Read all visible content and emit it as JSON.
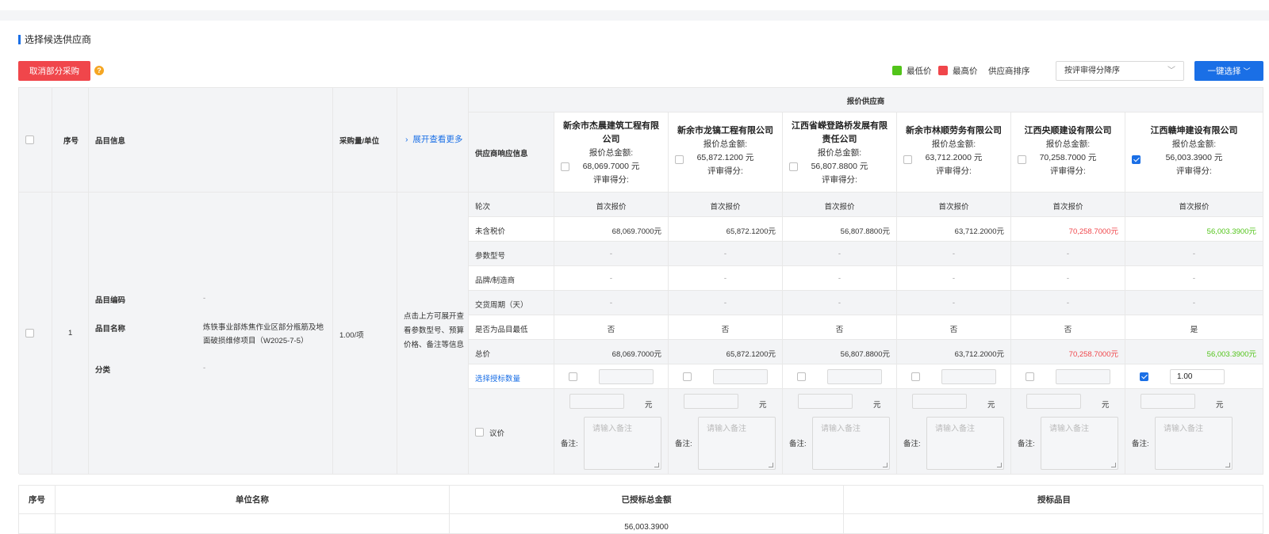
{
  "section_title": "选择候选供应商",
  "toolbar": {
    "cancel_label": "取消部分采购",
    "help_glyph": "?",
    "legend_low": "最低价",
    "legend_high": "最高价",
    "sort_label": "供应商排序",
    "sort_value": "按评审得分降序",
    "select_label": "一键选择",
    "colors": {
      "low": "#52c41a",
      "high": "#f0464b",
      "primary": "#1a6fe6"
    }
  },
  "table": {
    "headers": {
      "index": "序号",
      "item_info": "品目信息",
      "qty_unit": "采购量/单位",
      "expand": "展开查看更多",
      "suppliers_group": "报价供应商",
      "response_info": "供应商响应信息"
    },
    "quote_total_label": "报价总金额:",
    "score_label": "评审得分:",
    "suppliers": [
      {
        "name": "新余市杰晨建筑工程有限公司",
        "total": "68,069.7000 元",
        "checked": false,
        "round": "首次报价",
        "untaxed": "68,069.7000元",
        "param": "-",
        "brand": "-",
        "delivery": "-",
        "lowest": "否",
        "price": "68,069.7000元",
        "price_tag": "",
        "qty": ""
      },
      {
        "name": "新余市龙镐工程有限公司",
        "total": "65,872.1200 元",
        "checked": false,
        "round": "首次报价",
        "untaxed": "65,872.1200元",
        "param": "-",
        "brand": "-",
        "delivery": "-",
        "lowest": "否",
        "price": "65,872.1200元",
        "price_tag": "",
        "qty": ""
      },
      {
        "name": "江西省嵘登路桥发展有限责任公司",
        "total": "56,807.8800 元",
        "checked": false,
        "round": "首次报价",
        "untaxed": "56,807.8800元",
        "param": "-",
        "brand": "-",
        "delivery": "-",
        "lowest": "否",
        "price": "56,807.8800元",
        "price_tag": "",
        "qty": ""
      },
      {
        "name": "新余市林顺劳务有限公司",
        "total": "63,712.2000 元",
        "checked": false,
        "round": "首次报价",
        "untaxed": "63,712.2000元",
        "param": "-",
        "brand": "-",
        "delivery": "-",
        "lowest": "否",
        "price": "63,712.2000元",
        "price_tag": "",
        "qty": ""
      },
      {
        "name": "江西央顺建设有限公司",
        "total": "70,258.7000 元",
        "checked": false,
        "round": "首次报价",
        "untaxed": "70,258.7000元",
        "param": "-",
        "brand": "-",
        "delivery": "-",
        "lowest": "否",
        "price": "70,258.7000元",
        "price_tag": "high",
        "qty": ""
      },
      {
        "name": "江西赣坤建设有限公司",
        "total": "56,003.3900 元",
        "checked": true,
        "round": "首次报价",
        "untaxed": "56,003.3900元",
        "param": "-",
        "brand": "-",
        "delivery": "-",
        "lowest": "是",
        "price": "56,003.3900元",
        "price_tag": "low",
        "qty": "1.00"
      }
    ],
    "row_labels": {
      "round": "轮次",
      "untaxed": "未含税价",
      "param": "参数型号",
      "brand": "品牌/制造商",
      "delivery": "交货周期（天）",
      "lowest": "是否为品目最低",
      "price": "总价",
      "award_qty": "选择授标数量",
      "negotiate": "议价"
    },
    "item": {
      "index": "1",
      "code_label": "品目编码",
      "code_value": "-",
      "name_label": "品目名称",
      "name_value": "炼铁事业部炼焦作业区部分瓶筋及地面破损维修项目（W2025-7-5）",
      "category_label": "分类",
      "category_value": "-",
      "qty_unit": "1.00/项",
      "expand_hint": "点击上方可展开查看参数型号、预算价格、备注等信息"
    },
    "yuan": "元",
    "remark_label": "备注:",
    "remark_placeholder": "请输入备注"
  },
  "summary": {
    "headers": [
      "序号",
      "单位名称",
      "已授标总金额",
      "授标品目"
    ],
    "peek_amount": "56,003.3900"
  }
}
